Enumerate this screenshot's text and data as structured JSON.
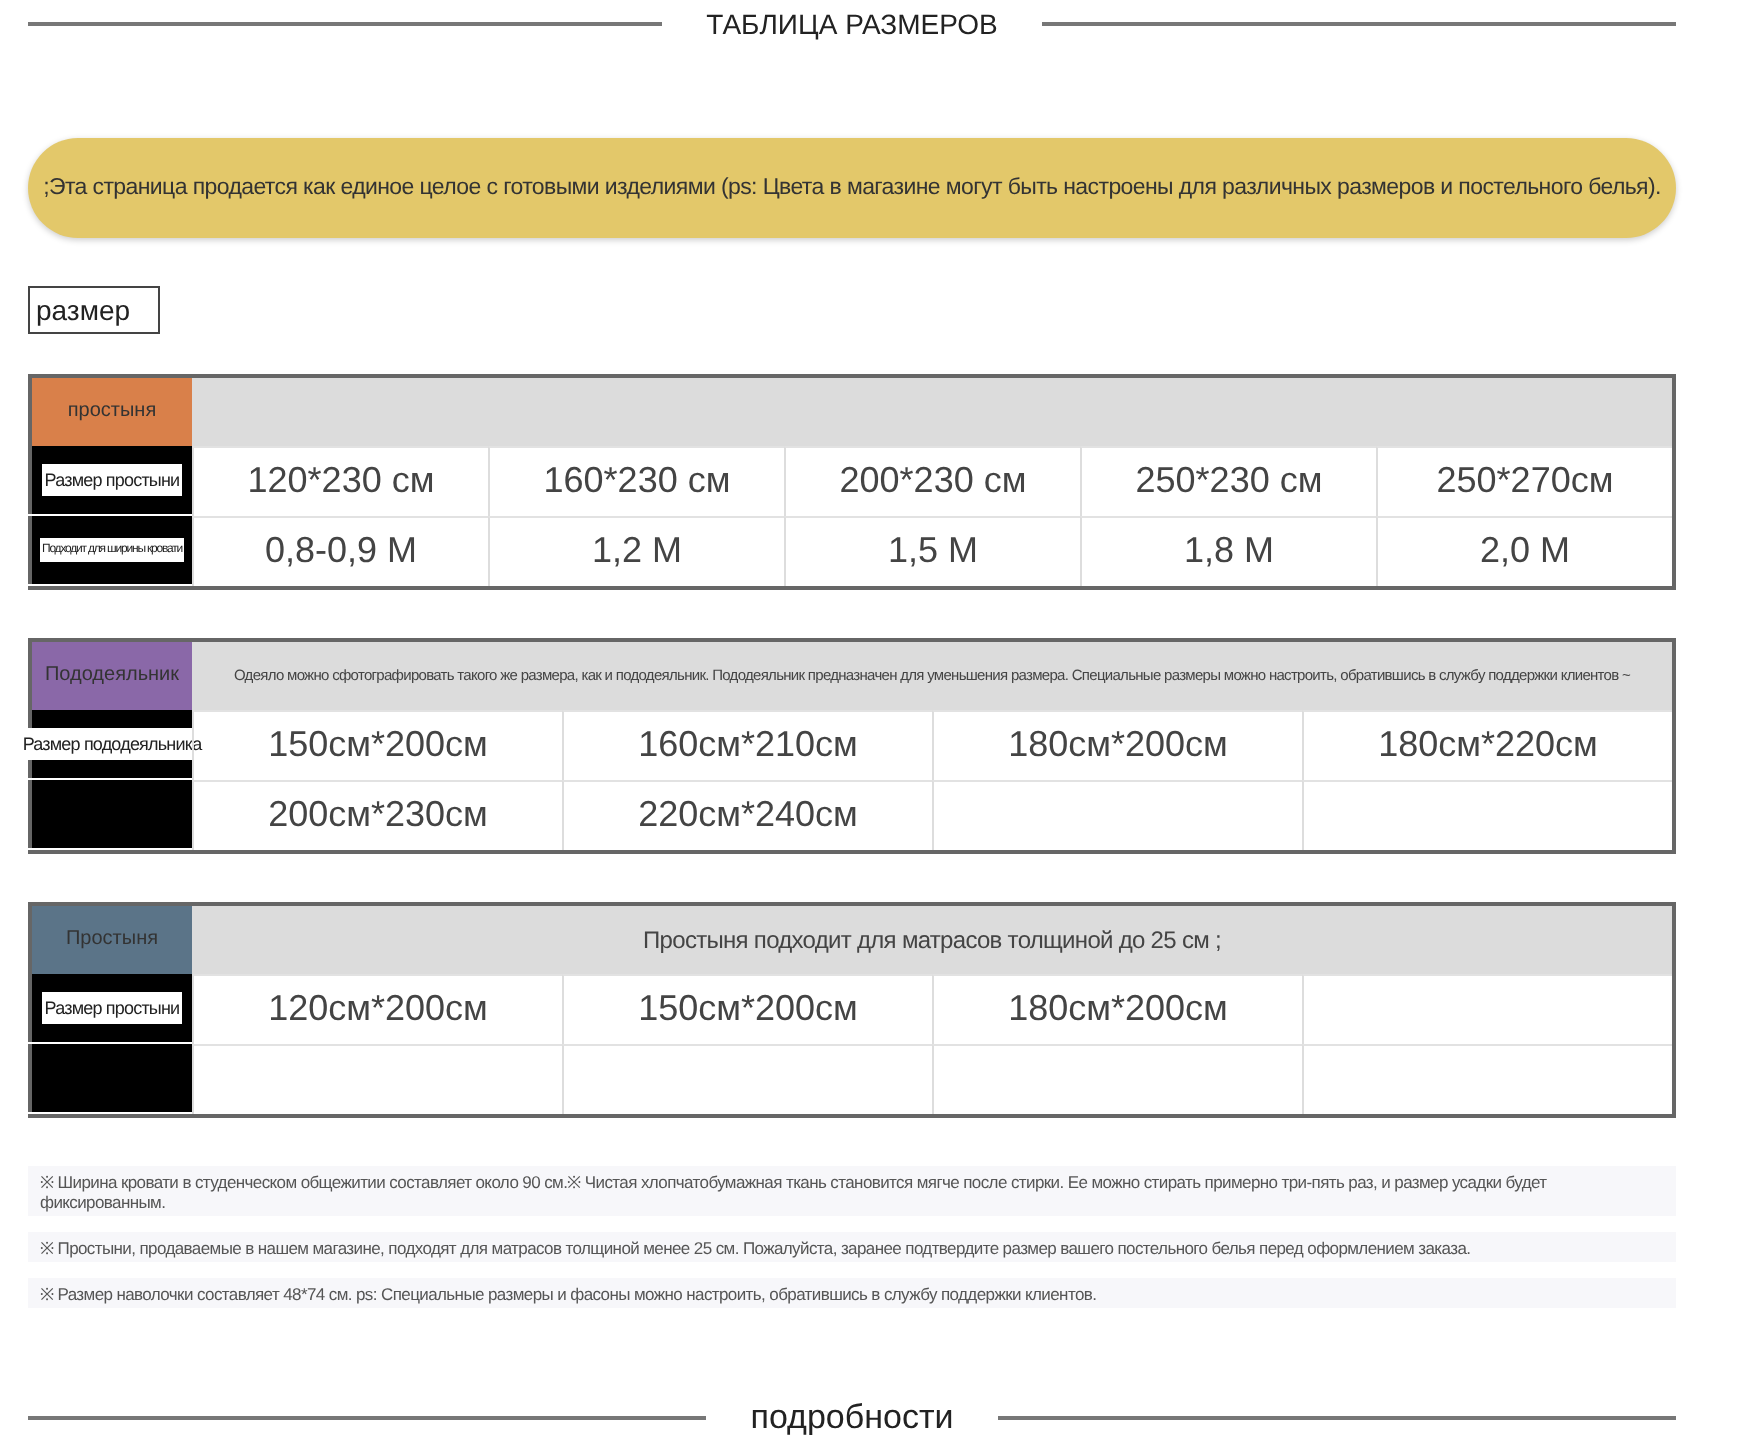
{
  "title": "ТАБЛИЦА РАЗМЕРОВ",
  "banner": ";Эта страница продается как единое целое с готовыми изделиями (ps: Цвета в магазине могут быть настроены для различных размеров и постельного белья).",
  "size_tag": "размер",
  "sections": [
    {
      "label": "простыня",
      "color": "#d9804a",
      "rows": [
        {
          "label": "Размер простыни",
          "cells": [
            "120*230 см",
            "160*230 см",
            "200*230 см",
            "250*230 см",
            "250*270см"
          ]
        },
        {
          "label": "Подходит для ширины кровати",
          "cells": [
            "0,8-0,9 М",
            "1,2 М",
            "1,5 М",
            "1,8 М",
            "2,0 М"
          ]
        }
      ]
    },
    {
      "label": "Пододеяльник",
      "color": "#8a68a8",
      "note": "Одеяло можно сфотографировать такого же размера, как и пододеяльник. Пододеяльник предназначен для уменьшения размера. Специальные размеры можно настроить, обратившись в службу поддержки клиентов ~",
      "rows": [
        {
          "label": "Размер пододеяльника",
          "cells": [
            "150см*200см",
            "160см*210см",
            "180см*200см",
            "180см*220см"
          ]
        },
        {
          "label": null,
          "cells": [
            "200см*230см",
            "220см*240см",
            null,
            null
          ]
        }
      ]
    },
    {
      "label": "Простыня",
      "color": "#5b7488",
      "note": "Простыня подходит для матрасов толщиной до 25 см ;",
      "rows": [
        {
          "label": "Размер простыни",
          "cells": [
            "120см*200см",
            "150см*200см",
            "180см*200см",
            null
          ]
        },
        {
          "label": null,
          "cells": [
            null,
            null,
            null,
            null
          ]
        }
      ]
    }
  ],
  "notes": [
    "※ Ширина кровати в студенческом общежитии составляет около 90 см.※ Чистая хлопчатобумажная ткань становится мягче после стирки. Ее можно стирать примерно три-пять раз, и размер усадки будет фиксированным.",
    "※ Простыни, продаваемые в нашем магазине, подходят для матрасов толщиной менее 25 см. Пожалуйста, заранее подтвердите размер вашего постельного белья перед оформлением заказа.",
    "※ Размер наволочки составляет 48*74 см. ps: Специальные размеры и фасоны можно настроить, обратившись в службу поддержки клиентов."
  ],
  "footer_title": "подробности"
}
